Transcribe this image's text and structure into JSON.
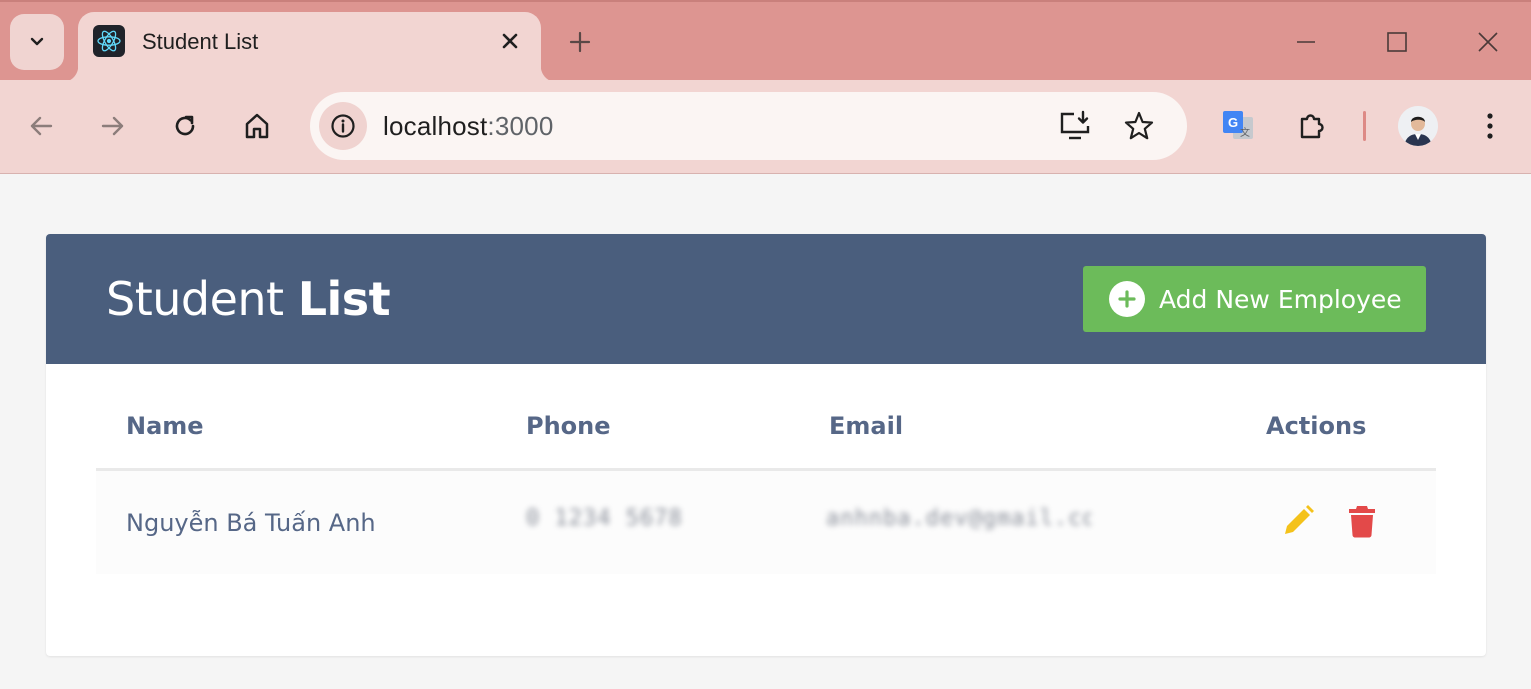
{
  "browser": {
    "tab_title": "Student List",
    "url_host": "localhost",
    "url_port": ":3000"
  },
  "page": {
    "title_light": "Student ",
    "title_bold": "List",
    "add_button_label": "Add New Employee"
  },
  "table": {
    "headers": [
      "Name",
      "Phone",
      "Email",
      "Actions"
    ],
    "rows": [
      {
        "name": "Nguyễn Bá Tuấn Anh",
        "phone": "0 1234 5678",
        "email": "anhnba.dev@gmail.com"
      }
    ]
  },
  "colors": {
    "header_bg": "#4a5e7d",
    "add_button": "#6cbb5a",
    "edit_icon": "#f4c21b",
    "delete_icon": "#e34949",
    "tab_strip": "#dd9591"
  },
  "icons": {
    "edit": "pencil-icon",
    "delete": "trash-icon",
    "add": "plus-circle-icon"
  }
}
